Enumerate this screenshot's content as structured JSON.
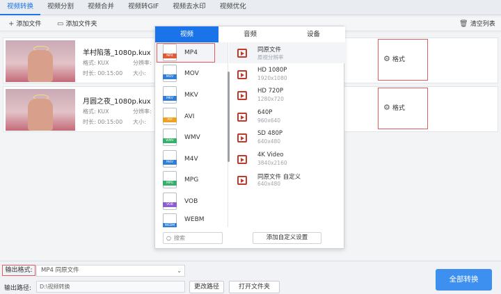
{
  "tabs": [
    "视频转换",
    "视频分割",
    "视频合并",
    "视频转GIF",
    "视频去水印",
    "视频优化"
  ],
  "toolbar": {
    "add_file": "添加文件",
    "add_folder": "添加文件夹",
    "clear_list": "清空列表"
  },
  "files": [
    {
      "name": "羊村陷落_1080p.kux",
      "format_label": "格式:",
      "format": "KUX",
      "duration_label": "时长:",
      "duration": "00:15:00",
      "resolution_label": "分辨率:",
      "size_label": "大小:",
      "format_button": "格式"
    },
    {
      "name": "月圆之夜_1080p.kux",
      "format_label": "格式:",
      "format": "KUX",
      "duration_label": "时长:",
      "duration": "00:15:00",
      "resolution_label": "分辨率:",
      "size_label": "大小:",
      "format_button": "格式"
    }
  ],
  "panel": {
    "tabs": [
      "视频",
      "音频",
      "设备"
    ],
    "formats": [
      {
        "name": "MP4",
        "color": "#e05a3a"
      },
      {
        "name": "MOV",
        "color": "#2f7fd8"
      },
      {
        "name": "MKV",
        "color": "#2f7fd8"
      },
      {
        "name": "AVI",
        "color": "#f0a020"
      },
      {
        "name": "WMV",
        "color": "#35b06a"
      },
      {
        "name": "M4V",
        "color": "#2f7fd8"
      },
      {
        "name": "MPG",
        "color": "#35b06a"
      },
      {
        "name": "VOB",
        "color": "#8e5bd0"
      },
      {
        "name": "WEBM",
        "color": "#2f7fd8"
      }
    ],
    "presets": [
      {
        "name": "同原文件",
        "res": "原视分辨率"
      },
      {
        "name": "HD 1080P",
        "res": "1920x1080"
      },
      {
        "name": "HD 720P",
        "res": "1280x720"
      },
      {
        "name": "640P",
        "res": "960x640"
      },
      {
        "name": "SD 480P",
        "res": "640x480"
      },
      {
        "name": "4K Video",
        "res": "3840x2160"
      },
      {
        "name": "同原文件 自定义",
        "res": "640x480"
      }
    ],
    "search_placeholder": "搜索",
    "custom_button": "添加自定义设置"
  },
  "bottom": {
    "output_format_label": "输出格式:",
    "output_format_value": "MP4   同原文件",
    "output_path_label": "输出路径:",
    "output_path_value": "D:\\视频转换",
    "change_path": "更改路径",
    "open_folder": "打开文件夹",
    "convert_all": "全部转换"
  }
}
